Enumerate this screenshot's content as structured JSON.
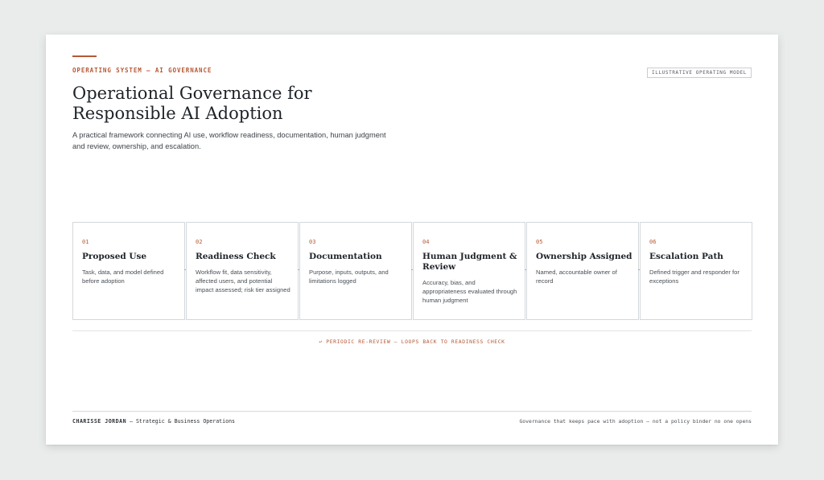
{
  "header": {
    "eyebrow": "OPERATING SYSTEM — AI GOVERNANCE",
    "badge": "ILLUSTRATIVE OPERATING MODEL",
    "title": "Operational Governance for Responsible AI Adoption",
    "subtitle": "A practical framework connecting AI use, workflow readiness, documentation, human judgment and review, ownership, and escalation."
  },
  "steps": [
    {
      "num": "01",
      "title": "Proposed Use",
      "desc": "Task, data, and model defined before adoption"
    },
    {
      "num": "02",
      "title": "Readiness Check",
      "desc": "Workflow fit, data sensitivity, affected users, and potential impact assessed; risk tier assigned"
    },
    {
      "num": "03",
      "title": "Documentation",
      "desc": "Purpose, inputs, outputs, and limitations logged"
    },
    {
      "num": "04",
      "title": "Human Judgment & Review",
      "desc": "Accuracy, bias, and appropriateness evaluated through human judgment"
    },
    {
      "num": "05",
      "title": "Ownership Assigned",
      "desc": "Named, accountable owner of record"
    },
    {
      "num": "06",
      "title": "Escalation Path",
      "desc": "Defined trigger and responder for exceptions"
    }
  ],
  "loop_note": "↩ PERIODIC RE-REVIEW — LOOPS BACK TO READINESS CHECK",
  "footer": {
    "author": "CHARISSE JORDAN",
    "role": " — Strategic & Business Operations",
    "tagline": "Governance that keeps pace with adoption — not a policy binder no one opens"
  },
  "colors": {
    "accent": "#b65834",
    "text": "#1e2328",
    "border": "#d4d8db"
  }
}
